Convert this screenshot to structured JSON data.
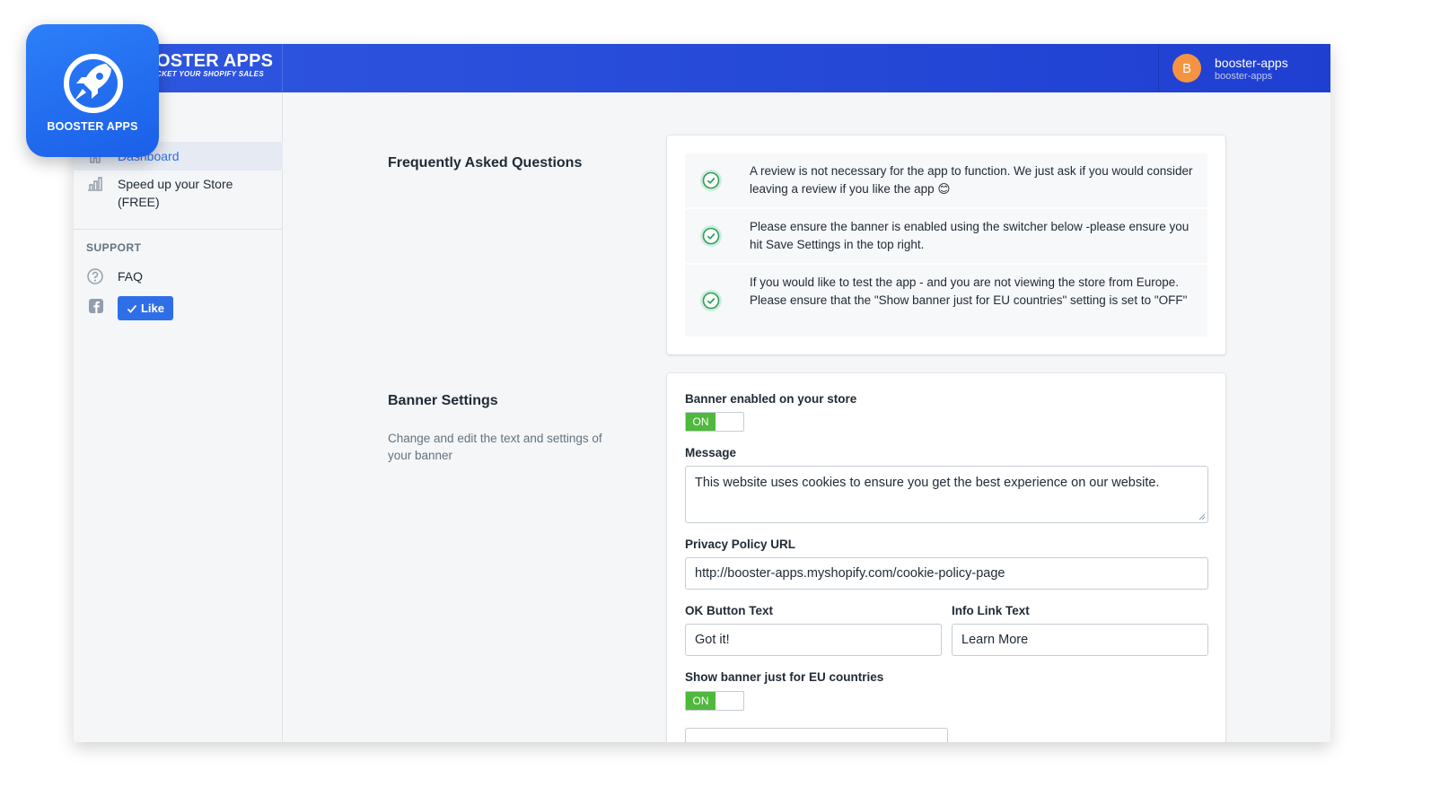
{
  "app_icon": {
    "label": "BOOSTER APPS"
  },
  "header": {
    "brand_name": "OSTER APPS",
    "brand_tagline": "CKET YOUR SHOPIFY SALES",
    "avatar_letter": "B",
    "user_name": "booster-apps",
    "user_shop": "booster-apps"
  },
  "sidebar": {
    "dashboard_label": "Dashboard",
    "speed_label_1": "Speed up your Store",
    "speed_label_2": "(FREE)",
    "support_heading": "SUPPORT",
    "faq_label": "FAQ",
    "like_label": "Like"
  },
  "faq_section": {
    "title": "Frequently Asked Questions",
    "items": [
      {
        "text": "A review is not necessary for the app to function. We just ask if you would consider leaving a review if you like the app 😊"
      },
      {
        "text": "Please ensure the banner is enabled using the switcher below -please ensure you hit Save Settings in the top right."
      },
      {
        "text": "If you would like to test the app - and you are not viewing the store from Europe. Please ensure that the \"Show banner just for EU countries\" setting is set to \"OFF\""
      }
    ]
  },
  "banner_section": {
    "title": "Banner Settings",
    "description": "Change and edit the text and settings of your banner",
    "enabled_label": "Banner enabled on your store",
    "enabled_state": "ON",
    "message_label": "Message",
    "message_value": "This website uses cookies to ensure you get the best experience on our website.",
    "privacy_label": "Privacy Policy URL",
    "privacy_value": "http://booster-apps.myshopify.com/cookie-policy-page",
    "ok_label": "OK Button Text",
    "ok_value": "Got it!",
    "info_label": "Info Link Text",
    "info_value": "Learn More",
    "eu_label": "Show banner just for EU countries",
    "eu_state": "ON"
  },
  "colors": {
    "header_blue": "#2f57e0",
    "toggle_green": "#50b83c",
    "like_blue": "#2e6fe8",
    "avatar_orange": "#f49342",
    "check_green": "#2e9e57"
  }
}
